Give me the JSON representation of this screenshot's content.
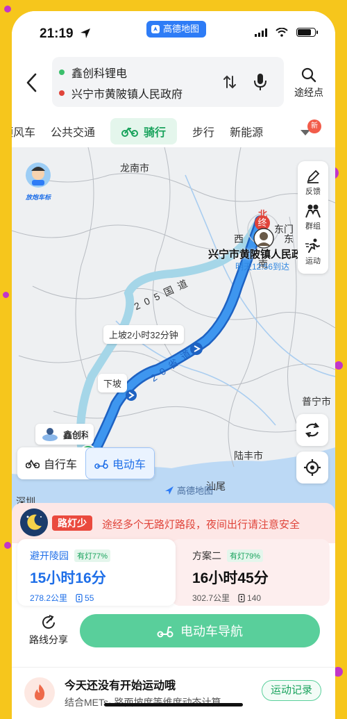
{
  "status_bar": {
    "time": "21:19",
    "app_name": "高德地图"
  },
  "route": {
    "origin": "鑫创科锂电",
    "destination": "兴宁市黄陂镇人民政府",
    "waypoint_label": "途经点"
  },
  "tabs": [
    {
      "label": "顺风车"
    },
    {
      "label": "公共交通"
    },
    {
      "label": "骑行",
      "active": true
    },
    {
      "label": "步行"
    },
    {
      "label": "新能源"
    }
  ],
  "tabs_more_badge": "新",
  "map": {
    "labels": {
      "longnan": "龙南市",
      "puning": "普宁市",
      "lufeng": "陆丰市",
      "shanwei": "汕尾",
      "shenzhen": "深圳",
      "xi": "西",
      "dongmen": "东门",
      "dong": "东",
      "nan": "南",
      "north_marker": "北",
      "end_marker": "终",
      "start_marker": "起",
      "destination": "兴宁市黄陂镇人民政府",
      "arrival": "明天12:56到达",
      "road_205": "2 0 5 国 道",
      "road_provincial": "2 0 省 道",
      "origin_short": "鑫创科锂电",
      "watermark": "高德地图",
      "mascot": "放炮车标"
    },
    "bubbles": {
      "uphill": "上坡2小时32分钟",
      "downhill": "下坡"
    },
    "side_tools": [
      {
        "label": "反馈",
        "icon": "pen-icon"
      },
      {
        "label": "群组",
        "icon": "group-icon"
      },
      {
        "label": "运动",
        "icon": "runner-icon"
      }
    ],
    "vehicle_options": [
      {
        "label": "自行车",
        "icon": "bicycle-icon"
      },
      {
        "label": "电动车",
        "icon": "scooter-icon",
        "selected": true
      }
    ]
  },
  "streetlight": {
    "badge": "路灯少",
    "text": "途经多个无路灯路段，夜间出行请注意安全"
  },
  "plans": [
    {
      "name": "避开陵园",
      "light": "有灯77%",
      "time": "15小时16分",
      "distance": "278.2公里",
      "lights": "55",
      "selected": true
    },
    {
      "name": "方案二",
      "light": "有灯79%",
      "time": "16小时45分",
      "distance": "302.7公里",
      "lights": "140"
    }
  ],
  "actions": {
    "share": "路线分享",
    "navigate": "电动车导航"
  },
  "exercise": {
    "title": "今天还没有开始运动哦",
    "subtitle": "结合METs· 路面坡度等维度动态计算",
    "button": "运动记录"
  },
  "colors": {
    "accent_green": "#1aa35d",
    "route_blue": "#2f86e0",
    "warning_red": "#ea4a3e"
  }
}
